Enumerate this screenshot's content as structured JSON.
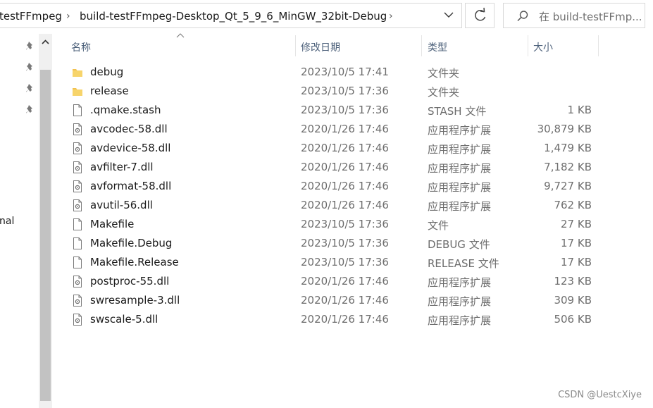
{
  "address": {
    "crumbs": [
      "testFFmpeg",
      "build-testFFmpeg-Desktop_Qt_5_9_6_MinGW_32bit-Debug"
    ],
    "separator": "›"
  },
  "search": {
    "placeholder": "在 build-testFFmp..."
  },
  "nav": {
    "partial_label": "nal"
  },
  "columns": {
    "name": "名称",
    "date": "修改日期",
    "type": "类型",
    "size": "大小"
  },
  "files": [
    {
      "name": "debug",
      "date": "2023/10/5 17:41",
      "type": "文件夹",
      "size": "",
      "icon": "folder-icon"
    },
    {
      "name": "release",
      "date": "2023/10/5 17:36",
      "type": "文件夹",
      "size": "",
      "icon": "folder-icon"
    },
    {
      "name": ".qmake.stash",
      "date": "2023/10/5 17:36",
      "type": "STASH 文件",
      "size": "1 KB",
      "icon": "file-icon"
    },
    {
      "name": "avcodec-58.dll",
      "date": "2020/1/26 17:46",
      "type": "应用程序扩展",
      "size": "30,879 KB",
      "icon": "dll-icon"
    },
    {
      "name": "avdevice-58.dll",
      "date": "2020/1/26 17:46",
      "type": "应用程序扩展",
      "size": "1,479 KB",
      "icon": "dll-icon"
    },
    {
      "name": "avfilter-7.dll",
      "date": "2020/1/26 17:46",
      "type": "应用程序扩展",
      "size": "7,182 KB",
      "icon": "dll-icon"
    },
    {
      "name": "avformat-58.dll",
      "date": "2020/1/26 17:46",
      "type": "应用程序扩展",
      "size": "9,727 KB",
      "icon": "dll-icon"
    },
    {
      "name": "avutil-56.dll",
      "date": "2020/1/26 17:46",
      "type": "应用程序扩展",
      "size": "762 KB",
      "icon": "dll-icon"
    },
    {
      "name": "Makefile",
      "date": "2023/10/5 17:36",
      "type": "文件",
      "size": "27 KB",
      "icon": "file-icon"
    },
    {
      "name": "Makefile.Debug",
      "date": "2023/10/5 17:36",
      "type": "DEBUG 文件",
      "size": "17 KB",
      "icon": "file-icon"
    },
    {
      "name": "Makefile.Release",
      "date": "2023/10/5 17:36",
      "type": "RELEASE 文件",
      "size": "17 KB",
      "icon": "file-icon"
    },
    {
      "name": "postproc-55.dll",
      "date": "2020/1/26 17:46",
      "type": "应用程序扩展",
      "size": "123 KB",
      "icon": "dll-icon"
    },
    {
      "name": "swresample-3.dll",
      "date": "2020/1/26 17:46",
      "type": "应用程序扩展",
      "size": "309 KB",
      "icon": "dll-icon"
    },
    {
      "name": "swscale-5.dll",
      "date": "2020/1/26 17:46",
      "type": "应用程序扩展",
      "size": "506 KB",
      "icon": "dll-icon"
    }
  ],
  "watermark": "CSDN @UestcXiye",
  "colors": {
    "folder": "#f2c14e",
    "header_text": "#4c607a",
    "secondary_text": "#6d6d6d"
  }
}
